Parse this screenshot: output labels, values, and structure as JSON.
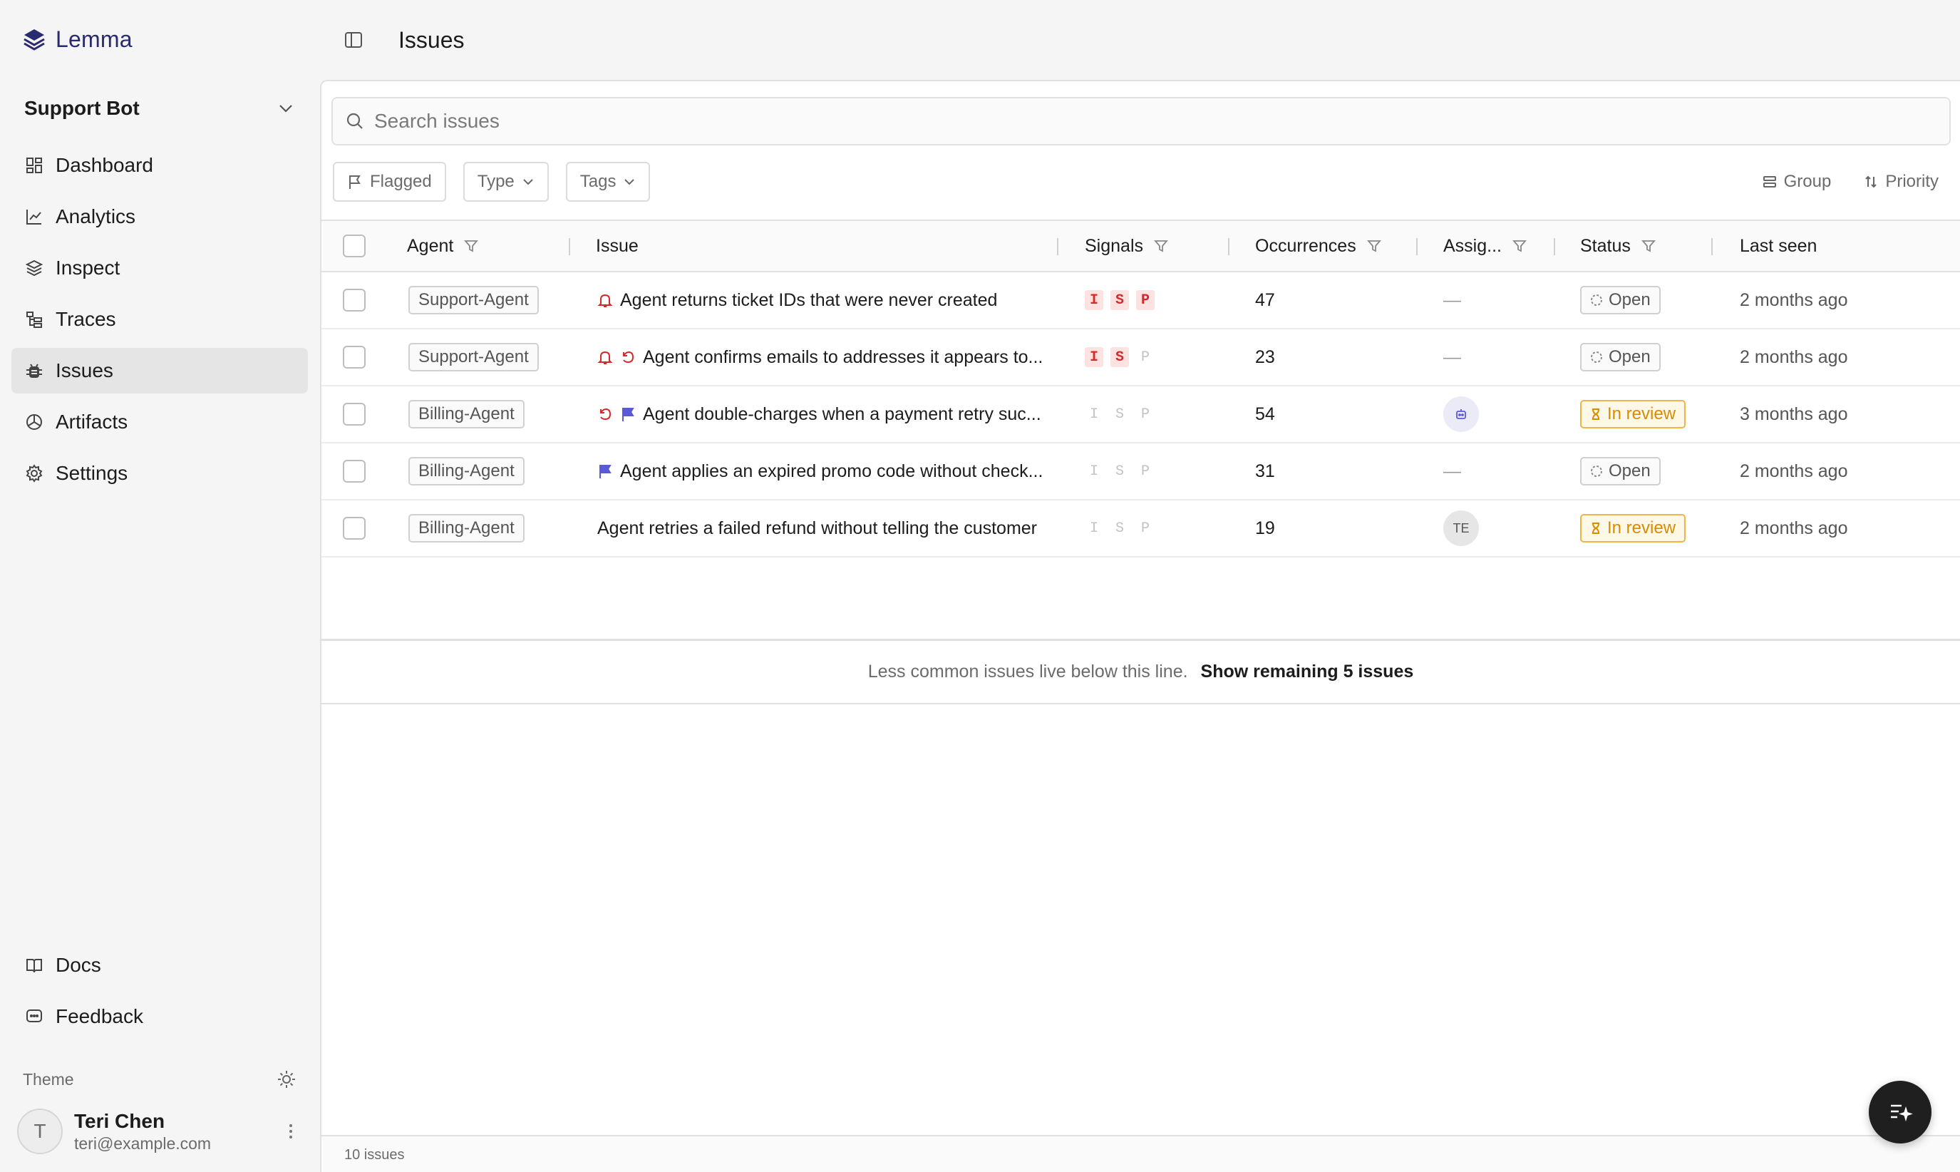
{
  "app": {
    "name": "Lemma",
    "project": "Support Bot"
  },
  "sidebar": {
    "nav": [
      {
        "label": "Dashboard",
        "icon": "dashboard-icon"
      },
      {
        "label": "Analytics",
        "icon": "analytics-icon"
      },
      {
        "label": "Inspect",
        "icon": "layers-icon"
      },
      {
        "label": "Traces",
        "icon": "traces-icon"
      },
      {
        "label": "Issues",
        "icon": "bug-icon",
        "active": true
      },
      {
        "label": "Artifacts",
        "icon": "artifacts-icon"
      },
      {
        "label": "Settings",
        "icon": "gear-icon"
      }
    ],
    "bottom": [
      {
        "label": "Docs",
        "icon": "book-icon"
      },
      {
        "label": "Feedback",
        "icon": "chat-icon"
      }
    ],
    "theme_label": "Theme",
    "user": {
      "initial": "T",
      "name": "Teri Chen",
      "email": "teri@example.com"
    }
  },
  "header": {
    "title": "Issues"
  },
  "search": {
    "placeholder": "Search issues",
    "value": ""
  },
  "filters": {
    "flagged": "Flagged",
    "type": "Type",
    "tags": "Tags"
  },
  "actions": {
    "group": "Group",
    "priority": "Priority"
  },
  "table": {
    "columns": {
      "agent": "Agent",
      "issue": "Issue",
      "signals": "Signals",
      "occurrences": "Occurrences",
      "assignee": "Assig...",
      "status": "Status",
      "last_seen": "Last seen"
    },
    "rows": [
      {
        "agent": "Support-Agent",
        "icons": [
          "bell"
        ],
        "title": "Agent returns ticket IDs that were never created",
        "signals": [
          {
            "letter": "I",
            "on": true
          },
          {
            "letter": "S",
            "on": true
          },
          {
            "letter": "P",
            "on": true
          }
        ],
        "occurrences": "47",
        "assignee": "—",
        "assignee_type": "none",
        "status": "Open",
        "status_kind": "open",
        "last_seen": "2 months ago"
      },
      {
        "agent": "Support-Agent",
        "icons": [
          "bell",
          "undo"
        ],
        "title": "Agent confirms emails to addresses it appears to...",
        "signals": [
          {
            "letter": "I",
            "on": true
          },
          {
            "letter": "S",
            "on": true
          },
          {
            "letter": "P",
            "on": false
          }
        ],
        "occurrences": "23",
        "assignee": "—",
        "assignee_type": "none",
        "status": "Open",
        "status_kind": "open",
        "last_seen": "2 months ago"
      },
      {
        "agent": "Billing-Agent",
        "icons": [
          "undo",
          "flag"
        ],
        "title": "Agent double-charges when a payment retry suc...",
        "signals": [
          {
            "letter": "I",
            "on": false
          },
          {
            "letter": "S",
            "on": false
          },
          {
            "letter": "P",
            "on": false
          }
        ],
        "occurrences": "54",
        "assignee": "",
        "assignee_type": "bot",
        "status": "In review",
        "status_kind": "review",
        "last_seen": "3 months ago"
      },
      {
        "agent": "Billing-Agent",
        "icons": [
          "flag"
        ],
        "title": "Agent applies an expired promo code without check...",
        "signals": [
          {
            "letter": "I",
            "on": false
          },
          {
            "letter": "S",
            "on": false
          },
          {
            "letter": "P",
            "on": false
          }
        ],
        "occurrences": "31",
        "assignee": "—",
        "assignee_type": "none",
        "status": "Open",
        "status_kind": "open",
        "last_seen": "2 months ago"
      },
      {
        "agent": "Billing-Agent",
        "icons": [],
        "title": "Agent retries a failed refund without telling the customer",
        "signals": [
          {
            "letter": "I",
            "on": false
          },
          {
            "letter": "S",
            "on": false
          },
          {
            "letter": "P",
            "on": false
          }
        ],
        "occurrences": "19",
        "assignee": "TE",
        "assignee_type": "initials",
        "status": "In review",
        "status_kind": "review",
        "last_seen": "2 months ago"
      }
    ]
  },
  "show_more": {
    "note": "Less common issues live below this line.",
    "link": "Show remaining 5 issues"
  },
  "footer": {
    "count": "10 issues"
  },
  "colors": {
    "accent": "#2a2a6e",
    "signal_red": "#d42a2a",
    "review_amber": "#d98b00",
    "flag_blue": "#5a5ad6"
  }
}
